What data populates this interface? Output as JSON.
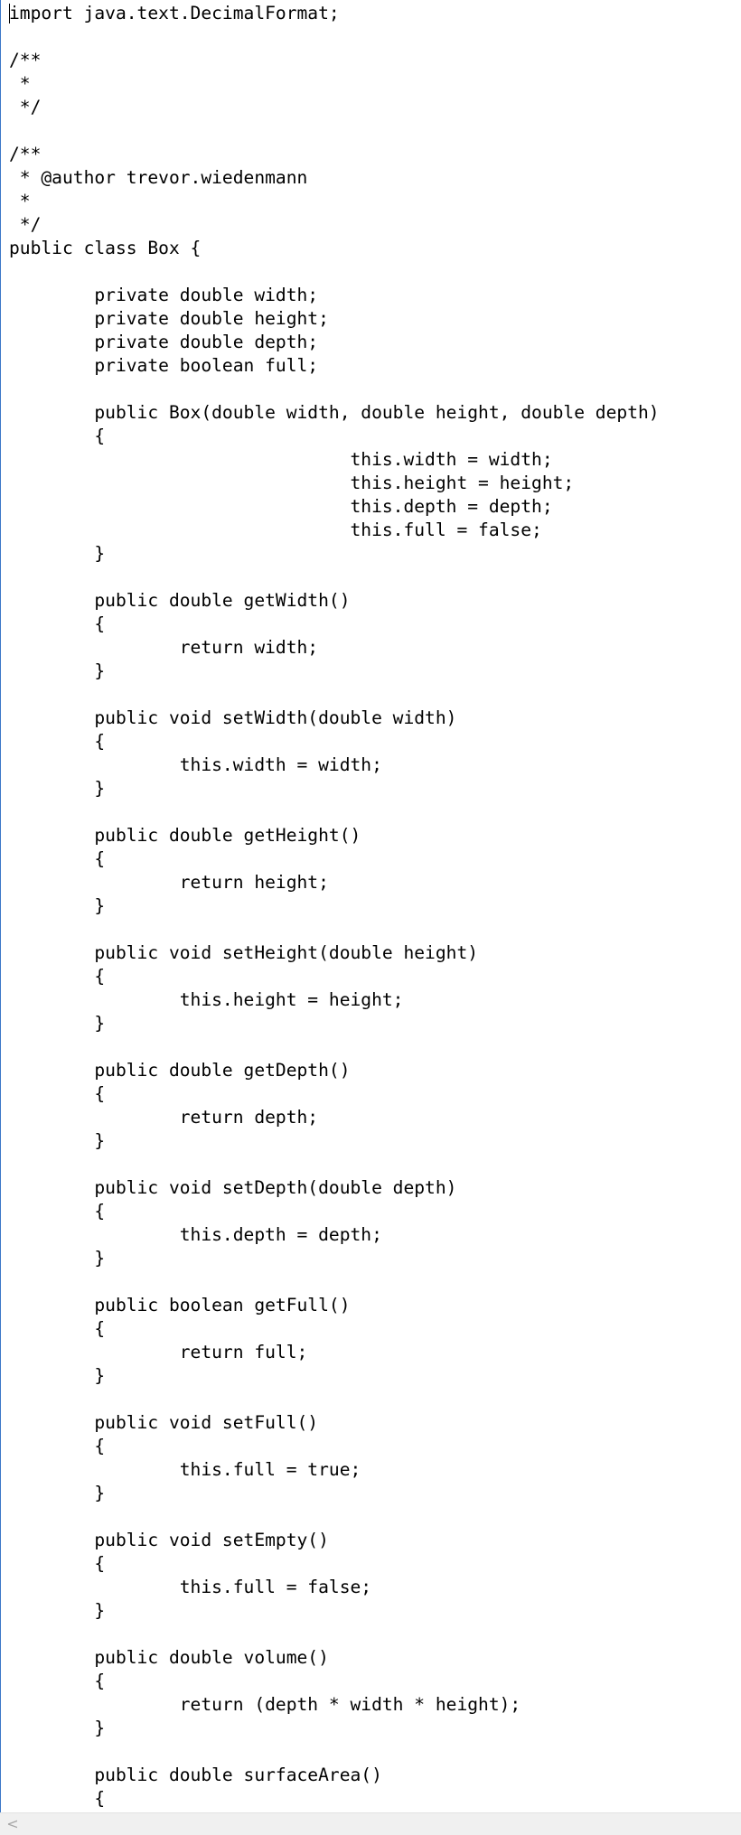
{
  "editor": {
    "code_lines": [
      "import java.text.DecimalFormat;",
      "",
      "/**",
      " *",
      " */",
      "",
      "/**",
      " * @author trevor.wiedenmann",
      " *",
      " */",
      "public class Box {",
      "",
      "        private double width;",
      "        private double height;",
      "        private double depth;",
      "        private boolean full;",
      "",
      "        public Box(double width, double height, double depth)",
      "        {",
      "                                this.width = width;",
      "                                this.height = height;",
      "                                this.depth = depth;",
      "                                this.full = false;",
      "        }",
      "",
      "        public double getWidth()",
      "        {",
      "                return width;",
      "        }",
      "",
      "        public void setWidth(double width)",
      "        {",
      "                this.width = width;",
      "        }",
      "",
      "        public double getHeight()",
      "        {",
      "                return height;",
      "        }",
      "",
      "        public void setHeight(double height)",
      "        {",
      "                this.height = height;",
      "        }",
      "",
      "        public double getDepth()",
      "        {",
      "                return depth;",
      "        }",
      "",
      "        public void setDepth(double depth)",
      "        {",
      "                this.depth = depth;",
      "        }",
      "",
      "        public boolean getFull()",
      "        {",
      "                return full;",
      "        }",
      "",
      "        public void setFull()",
      "        {",
      "                this.full = true;",
      "        }",
      "",
      "        public void setEmpty()",
      "        {",
      "                this.full = false;",
      "        }",
      "",
      "        public double volume()",
      "        {",
      "                return (depth * width * height);",
      "        }",
      "",
      "        public double surfaceArea()",
      "        {"
    ]
  },
  "scrollbar": {
    "left_arrow_glyph": "<",
    "left_arrow_icon": "chevron-left-icon"
  },
  "colors": {
    "text": "#000000",
    "background": "#ffffff",
    "editor_border": "#3c78c8",
    "scrollbar_track": "#f0f0f0",
    "scrollbar_arrow": "#a6a6a6"
  }
}
